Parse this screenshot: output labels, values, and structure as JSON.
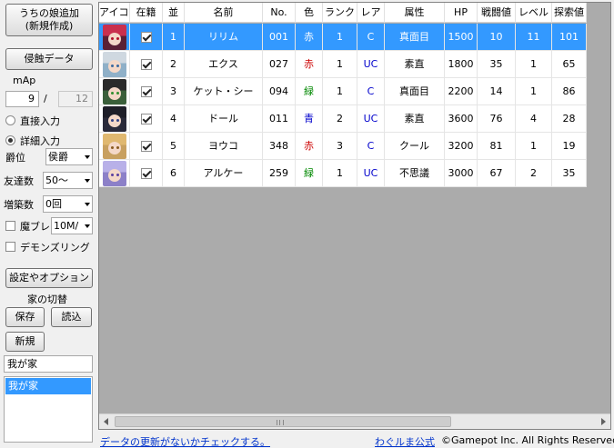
{
  "sidebar": {
    "add_button": [
      "うちの娘追加",
      "(新規作成)"
    ],
    "erosion_button": "侵蝕データ",
    "map_label": "mAp",
    "map_current": "9",
    "map_sep": "/",
    "map_max": "12",
    "radio_direct": "直接入力",
    "radio_detail": "詳細入力",
    "rank_label": "爵位",
    "rank_value": "侯爵",
    "friends_label": "友達数",
    "friends_value": "50〜",
    "expand_label": "増築数",
    "expand_value": "0回",
    "magic_label": "魔ブレ",
    "magic_value": "10M/",
    "demon_ring_label": "デモンズリング",
    "settings_button": "設定やオプション",
    "house_switch_label": "家の切替",
    "save_button": "保存",
    "load_button": "読込",
    "new_button": "新規",
    "house_name": "我が家",
    "house_list": [
      "我が家"
    ]
  },
  "grid": {
    "columns": [
      "アイコン",
      "在籍",
      "並",
      "名前",
      "No.",
      "色",
      "ランク",
      "レア",
      "属性",
      "HP",
      "戦闘値",
      "レベル",
      "探索値"
    ],
    "rows": [
      {
        "idx": "1",
        "name": "リリム",
        "no": "001",
        "color": "赤",
        "color_hex": "#cc0000",
        "rank": "1",
        "rare": "C",
        "attr": "真面目",
        "hp": "1500",
        "battle": "10",
        "level": "11",
        "explore": "101",
        "avatar": {
          "bg": "#5a2035",
          "hair": "#c9304e",
          "eye": "#b0102a"
        }
      },
      {
        "idx": "2",
        "name": "エクス",
        "no": "027",
        "color": "赤",
        "color_hex": "#cc0000",
        "rank": "1",
        "rare": "UC",
        "attr": "素直",
        "hp": "1800",
        "battle": "35",
        "level": "1",
        "explore": "65",
        "avatar": {
          "bg": "#8fb0c8",
          "hair": "#cfd8e0",
          "eye": "#3a6aa0"
        }
      },
      {
        "idx": "3",
        "name": "ケット・シー",
        "no": "094",
        "color": "緑",
        "color_hex": "#008800",
        "rank": "1",
        "rare": "C",
        "attr": "真面目",
        "hp": "2200",
        "battle": "14",
        "level": "1",
        "explore": "86",
        "avatar": {
          "bg": "#3a5f3a",
          "hair": "#2b2b2b",
          "eye": "#2f8f2f"
        }
      },
      {
        "idx": "4",
        "name": "ドール",
        "no": "011",
        "color": "青",
        "color_hex": "#0000cc",
        "rank": "2",
        "rare": "UC",
        "attr": "素直",
        "hp": "3600",
        "battle": "76",
        "level": "4",
        "explore": "28",
        "avatar": {
          "bg": "#2a2a3a",
          "hair": "#1e1e28",
          "eye": "#334488"
        }
      },
      {
        "idx": "5",
        "name": "ヨウコ",
        "no": "348",
        "color": "赤",
        "color_hex": "#cc0000",
        "rank": "3",
        "rare": "C",
        "attr": "クール",
        "hp": "3200",
        "battle": "81",
        "level": "1",
        "explore": "19",
        "avatar": {
          "bg": "#c8a060",
          "hair": "#e0b870",
          "eye": "#8a5a20"
        }
      },
      {
        "idx": "6",
        "name": "アルケー",
        "no": "259",
        "color": "緑",
        "color_hex": "#008800",
        "rank": "1",
        "rare": "UC",
        "attr": "不思議",
        "hp": "3000",
        "battle": "67",
        "level": "2",
        "explore": "35",
        "avatar": {
          "bg": "#8c80c8",
          "hair": "#b8b0e8",
          "eye": "#5a40a0"
        }
      }
    ],
    "uc_color": "#0000cc",
    "selected_row": 0
  },
  "footer": {
    "update_link": "データの更新がないかチェックする。",
    "official_link": "わぐルま公式",
    "copyright": "©Gamepot Inc. All Rights Reserved."
  }
}
